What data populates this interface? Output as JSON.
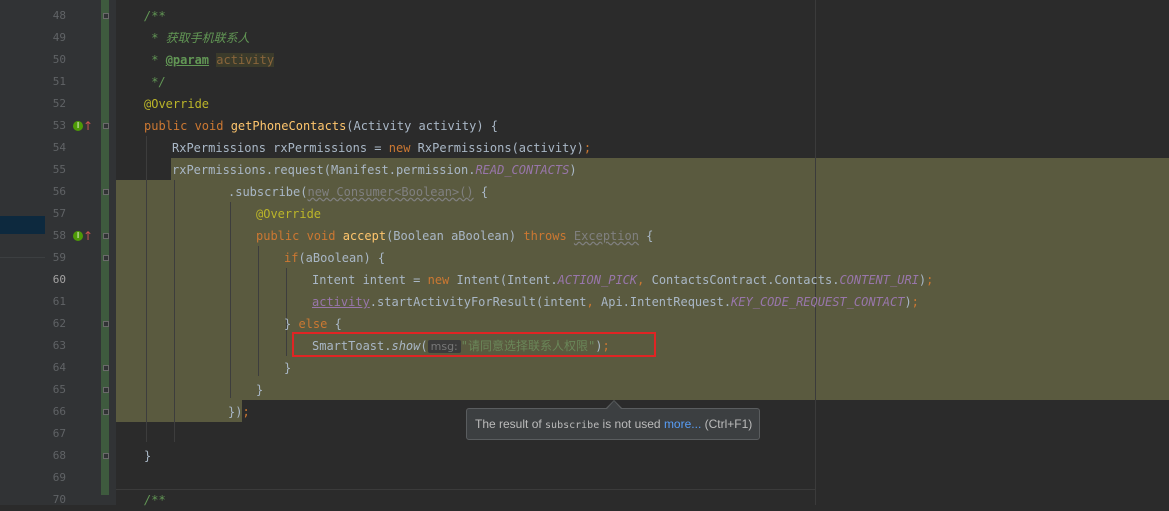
{
  "editor": {
    "line_numbers": [
      "48",
      "49",
      "50",
      "51",
      "52",
      "53",
      "54",
      "55",
      "56",
      "57",
      "58",
      "59",
      "60",
      "61",
      "62",
      "63",
      "64",
      "65",
      "66",
      "67",
      "68",
      "69",
      "70"
    ],
    "current_line": "60"
  },
  "code": {
    "l48": "/**",
    "l49": " * 获取手机联系人",
    "l50_star": " * ",
    "l50_tag": "@param",
    "l50_name": "activity",
    "l51": " */",
    "l52": "@Override",
    "l53_kw": "public void ",
    "l53_fn": "getPhoneContacts",
    "l53_rest": "(Activity activity) {",
    "l54_a": "RxPermissions rxPermissions = ",
    "l54_new": "new ",
    "l54_b": "RxPermissions(activity)",
    "l54_semi": ";",
    "l55_a": "rxPermissions.request(Manifest.permission.",
    "l55_const": "READ_CONTACTS",
    "l55_b": ")",
    "l56_a": ".subscribe(",
    "l56_b": "new Consumer<Boolean>()",
    "l56_c": " {",
    "l57": "@Override",
    "l58_kw": "public void ",
    "l58_fn": "accept",
    "l58_a": "(Boolean aBoolean) ",
    "l58_throws": "throws ",
    "l58_exc": "Exception",
    "l58_b": " {",
    "l59_if": "if",
    "l59_rest": "(aBoolean) {",
    "l60_a": "Intent intent = ",
    "l60_new": "new ",
    "l60_b": "Intent(Intent.",
    "l60_c1": "ACTION_PICK",
    "l60_comma": ", ",
    "l60_d": "ContactsContract.Contacts.",
    "l60_c2": "CONTENT_URI",
    "l60_e": ")",
    "l60_semi": ";",
    "l61_field": "activity",
    "l61_a": ".startActivityForResult(intent",
    "l61_comma": ", ",
    "l61_b": "Api.IntentRequest.",
    "l61_const": "KEY_CODE_REQUEST_CONTACT",
    "l61_c": ")",
    "l61_semi": ";",
    "l62_a": "} ",
    "l62_else": "else",
    "l62_b": " {",
    "l63_a": "SmartToast.",
    "l63_fn": "show",
    "l63_paren": "(",
    "l63_hint": "msg:",
    "l63_str": "\"请同意选择联系人权限\"",
    "l63_end": ")",
    "l63_semi": ";",
    "l64": "}",
    "l65": "}",
    "l66_a": "})",
    "l66_semi": ";",
    "l68": "}",
    "l70": "/**"
  },
  "tooltip": {
    "prefix": "The result of ",
    "code": "subscribe",
    "middle": " is not used ",
    "link": "more...",
    "shortcut": " (Ctrl+F1)"
  },
  "gutter_icons": {
    "implements": "I",
    "override_arrow": "↑"
  }
}
